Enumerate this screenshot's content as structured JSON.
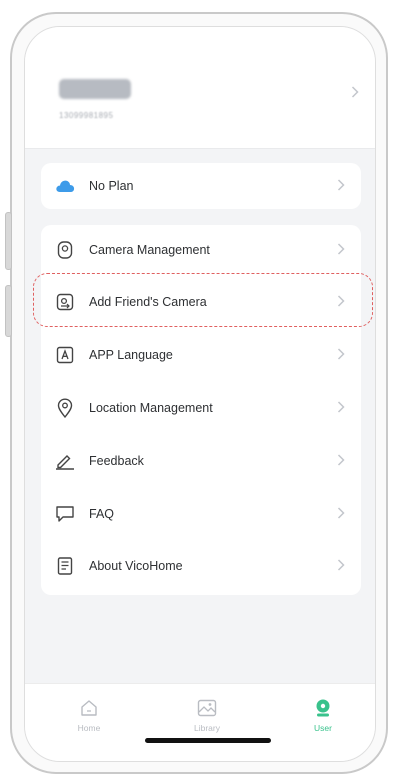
{
  "profile": {
    "name": "",
    "phone": "13099981895"
  },
  "plan": {
    "label": "No Plan"
  },
  "menu": {
    "items": [
      {
        "label": "Camera Management",
        "icon": "camera-icon"
      },
      {
        "label": "Add Friend's Camera",
        "icon": "share-camera-icon"
      },
      {
        "label": "APP Language",
        "icon": "language-icon"
      },
      {
        "label": "Location Management",
        "icon": "location-pin-icon"
      },
      {
        "label": "Feedback",
        "icon": "pen-icon"
      },
      {
        "label": "FAQ",
        "icon": "chat-bubble-icon"
      },
      {
        "label": "About VicoHome",
        "icon": "info-book-icon"
      }
    ]
  },
  "tabs": [
    {
      "label": "Home",
      "icon": "home-icon",
      "active": false
    },
    {
      "label": "Library",
      "icon": "image-icon",
      "active": false
    },
    {
      "label": "User",
      "icon": "user-icon",
      "active": true
    }
  ],
  "colors": {
    "accent": "#39c28c",
    "cloud": "#3d9be9",
    "highlight": "#e06060"
  }
}
